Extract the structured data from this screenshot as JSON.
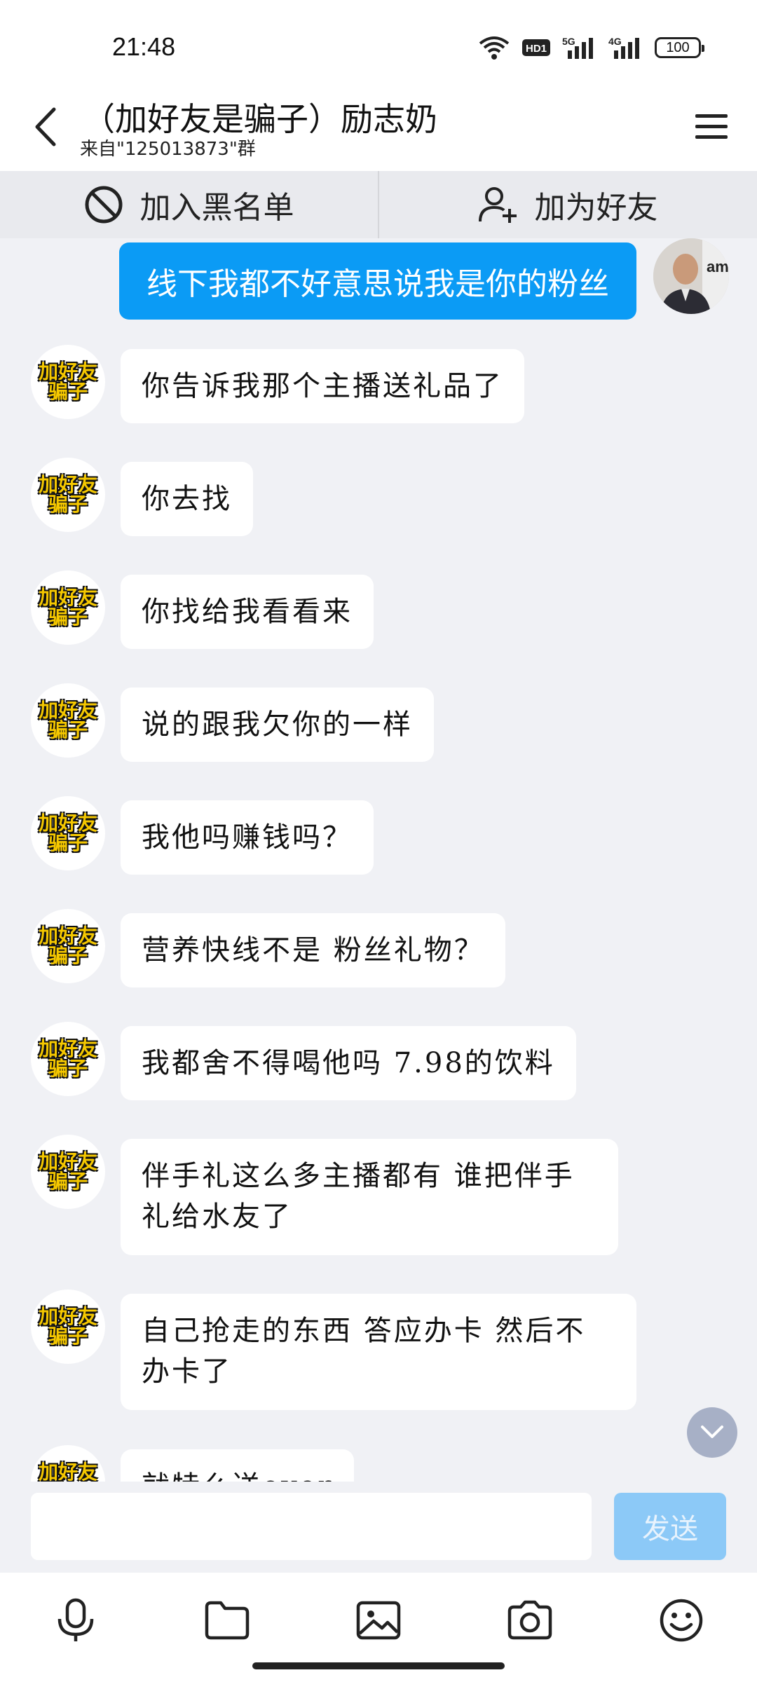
{
  "status_bar": {
    "time": "21:48",
    "network_5g": "5G",
    "network_4g": "4G",
    "hd": "HD1",
    "battery": "100"
  },
  "header": {
    "title": "（加好友是骗子）励志奶",
    "subtitle": "来自\"125013873\"群"
  },
  "actions": {
    "block_label": "加入黑名单",
    "add_friend_label": "加为好友"
  },
  "sent_message": "线下我都不好意思说我是你的粉丝",
  "contact_avatar_text": "加好友骗子",
  "messages": [
    "你告诉我那个主播送礼品了",
    "你去找",
    "你找给我看看来",
    "说的跟我欠你的一样",
    "我他吗赚钱吗？",
    "营养快线不是 粉丝礼物？",
    "我都舍不得喝他吗 7.98的饮料",
    "伴手礼这么多主播都有 谁把伴手礼给水友了",
    "自己抢走的东西  答应办卡   然后不办卡了",
    "就特么送over"
  ],
  "input": {
    "placeholder": "",
    "send_label": "发送"
  },
  "colors": {
    "sent_bubble": "#0b9bf5",
    "send_button": "#8cc9f7",
    "background": "#f0f1f5"
  },
  "icons": {
    "toolbar": [
      "microphone-icon",
      "folder-icon",
      "image-icon",
      "camera-icon",
      "emoji-icon"
    ]
  }
}
